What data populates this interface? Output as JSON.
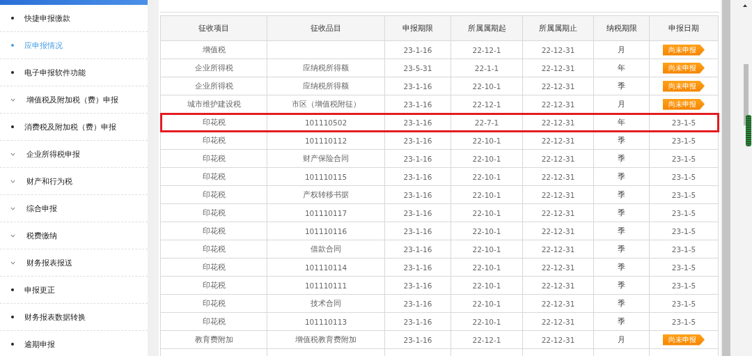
{
  "sidebar": {
    "items": [
      {
        "label": "快捷申报缴款",
        "kind": "link",
        "selected": false
      },
      {
        "label": "应申报情况",
        "kind": "link",
        "selected": true
      },
      {
        "label": "电子申报软件功能",
        "kind": "link",
        "selected": false
      },
      {
        "label": "增值税及附加税（费）申报",
        "kind": "group",
        "selected": false
      },
      {
        "label": "消费税及附加税（费）申报",
        "kind": "link",
        "selected": false
      },
      {
        "label": "企业所得税申报",
        "kind": "group",
        "selected": false
      },
      {
        "label": "财产和行为税",
        "kind": "group",
        "selected": false
      },
      {
        "label": "综合申报",
        "kind": "group",
        "selected": false
      },
      {
        "label": "税费缴纳",
        "kind": "group",
        "selected": false
      },
      {
        "label": "财务报表报送",
        "kind": "group",
        "selected": false
      },
      {
        "label": "申报更正",
        "kind": "link",
        "selected": false
      },
      {
        "label": "财务报表数据转换",
        "kind": "link",
        "selected": false
      },
      {
        "label": "逾期申报",
        "kind": "link",
        "selected": false
      }
    ]
  },
  "table": {
    "columns": [
      "征收项目",
      "征收品目",
      "申报期限",
      "所属属期起",
      "所属属期止",
      "纳税期限",
      "申报日期"
    ],
    "rows": [
      {
        "cells": [
          "增值税",
          "",
          "23-1-16",
          "22-12-1",
          "22-12-31",
          "月"
        ],
        "status": {
          "kind": "badge",
          "text": "尚未申报"
        },
        "highlighted": false
      },
      {
        "cells": [
          "企业所得税",
          "应纳税所得额",
          "23-5-31",
          "22-1-1",
          "22-12-31",
          "年"
        ],
        "status": {
          "kind": "badge",
          "text": "尚未申报"
        },
        "highlighted": false
      },
      {
        "cells": [
          "企业所得税",
          "应纳税所得额",
          "23-1-16",
          "22-10-1",
          "22-12-31",
          "季"
        ],
        "status": {
          "kind": "badge",
          "text": "尚未申报"
        },
        "highlighted": false
      },
      {
        "cells": [
          "城市维护建设税",
          "市区（增值税附征）",
          "23-1-16",
          "22-12-1",
          "22-12-31",
          "月"
        ],
        "status": {
          "kind": "badge",
          "text": "尚未申报"
        },
        "highlighted": false
      },
      {
        "cells": [
          "印花税",
          "101110502",
          "23-1-16",
          "22-7-1",
          "22-12-31",
          "年"
        ],
        "status": {
          "kind": "date",
          "text": "23-1-5"
        },
        "highlighted": true
      },
      {
        "cells": [
          "印花税",
          "101110112",
          "23-1-16",
          "22-10-1",
          "22-12-31",
          "季"
        ],
        "status": {
          "kind": "date",
          "text": "23-1-5"
        },
        "highlighted": false
      },
      {
        "cells": [
          "印花税",
          "财产保险合同",
          "23-1-16",
          "22-10-1",
          "22-12-31",
          "季"
        ],
        "status": {
          "kind": "date",
          "text": "23-1-5"
        },
        "highlighted": false
      },
      {
        "cells": [
          "印花税",
          "101110115",
          "23-1-16",
          "22-10-1",
          "22-12-31",
          "季"
        ],
        "status": {
          "kind": "date",
          "text": "23-1-5"
        },
        "highlighted": false
      },
      {
        "cells": [
          "印花税",
          "产权转移书据",
          "23-1-16",
          "22-10-1",
          "22-12-31",
          "季"
        ],
        "status": {
          "kind": "date",
          "text": "23-1-5"
        },
        "highlighted": false
      },
      {
        "cells": [
          "印花税",
          "101110117",
          "23-1-16",
          "22-10-1",
          "22-12-31",
          "季"
        ],
        "status": {
          "kind": "date",
          "text": "23-1-5"
        },
        "highlighted": false
      },
      {
        "cells": [
          "印花税",
          "101110116",
          "23-1-16",
          "22-10-1",
          "22-12-31",
          "季"
        ],
        "status": {
          "kind": "date",
          "text": "23-1-5"
        },
        "highlighted": false
      },
      {
        "cells": [
          "印花税",
          "借款合同",
          "23-1-16",
          "22-10-1",
          "22-12-31",
          "季"
        ],
        "status": {
          "kind": "date",
          "text": "23-1-5"
        },
        "highlighted": false
      },
      {
        "cells": [
          "印花税",
          "101110114",
          "23-1-16",
          "22-10-1",
          "22-12-31",
          "季"
        ],
        "status": {
          "kind": "date",
          "text": "23-1-5"
        },
        "highlighted": false
      },
      {
        "cells": [
          "印花税",
          "101110111",
          "23-1-16",
          "22-10-1",
          "22-12-31",
          "季"
        ],
        "status": {
          "kind": "date",
          "text": "23-1-5"
        },
        "highlighted": false
      },
      {
        "cells": [
          "印花税",
          "技术合同",
          "23-1-16",
          "22-10-1",
          "22-12-31",
          "季"
        ],
        "status": {
          "kind": "date",
          "text": "23-1-5"
        },
        "highlighted": false
      },
      {
        "cells": [
          "印花税",
          "101110113",
          "23-1-16",
          "22-10-1",
          "22-12-31",
          "季"
        ],
        "status": {
          "kind": "date",
          "text": "23-1-5"
        },
        "highlighted": false
      },
      {
        "cells": [
          "教育费附加",
          "增值税教育费附加",
          "23-1-16",
          "22-12-1",
          "22-12-31",
          "月"
        ],
        "status": {
          "kind": "badge",
          "text": "尚未申报"
        },
        "highlighted": false
      }
    ]
  }
}
